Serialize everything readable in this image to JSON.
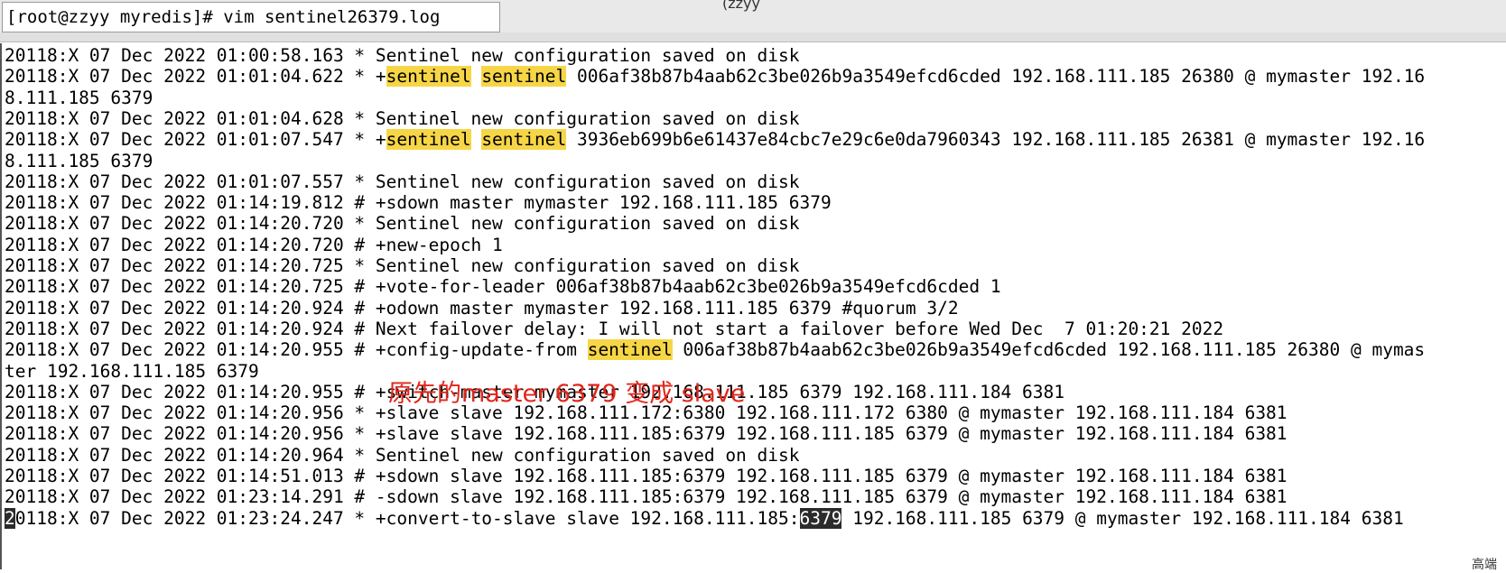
{
  "window": {
    "title_fragment": "(zzyy",
    "command": "[root@zzyy myredis]# vim sentinel26379.log"
  },
  "annotation": "原先的master 6379 变成 slave",
  "log_lines": [
    [
      {
        "t": "20118:X 07 Dec 2022 01:00:58.163 * Sentinel new configuration saved on disk"
      }
    ],
    [
      {
        "t": "20118:X 07 Dec 2022 01:01:04.622 * +"
      },
      {
        "t": "sentinel",
        "hl": true
      },
      {
        "t": " "
      },
      {
        "t": "sentinel",
        "hl": true
      },
      {
        "t": " 006af38b87b4aab62c3be026b9a3549efcd6cded 192.168.111.185 26380 @ mymaster 192.16"
      }
    ],
    [
      {
        "t": "8.111.185 6379"
      }
    ],
    [
      {
        "t": "20118:X 07 Dec 2022 01:01:04.628 * Sentinel new configuration saved on disk"
      }
    ],
    [
      {
        "t": "20118:X 07 Dec 2022 01:01:07.547 * +"
      },
      {
        "t": "sentinel",
        "hl": true
      },
      {
        "t": " "
      },
      {
        "t": "sentinel",
        "hl": true
      },
      {
        "t": " 3936eb699b6e61437e84cbc7e29c6e0da7960343 192.168.111.185 26381 @ mymaster 192.16"
      }
    ],
    [
      {
        "t": "8.111.185 6379"
      }
    ],
    [
      {
        "t": "20118:X 07 Dec 2022 01:01:07.557 * Sentinel new configuration saved on disk"
      }
    ],
    [
      {
        "t": "20118:X 07 Dec 2022 01:14:19.812 # +sdown master mymaster 192.168.111.185 6379"
      }
    ],
    [
      {
        "t": "20118:X 07 Dec 2022 01:14:20.720 * Sentinel new configuration saved on disk"
      }
    ],
    [
      {
        "t": "20118:X 07 Dec 2022 01:14:20.720 # +new-epoch 1"
      }
    ],
    [
      {
        "t": "20118:X 07 Dec 2022 01:14:20.725 * Sentinel new configuration saved on disk"
      }
    ],
    [
      {
        "t": "20118:X 07 Dec 2022 01:14:20.725 # +vote-for-leader 006af38b87b4aab62c3be026b9a3549efcd6cded 1"
      }
    ],
    [
      {
        "t": "20118:X 07 Dec 2022 01:14:20.924 # +odown master mymaster 192.168.111.185 6379 #quorum 3/2"
      }
    ],
    [
      {
        "t": "20118:X 07 Dec 2022 01:14:20.924 # Next failover delay: I will not start a failover before Wed Dec  7 01:20:21 2022"
      }
    ],
    [
      {
        "t": "20118:X 07 Dec 2022 01:14:20.955 # +config-update-from "
      },
      {
        "t": "sentinel",
        "hl": true
      },
      {
        "t": " 006af38b87b4aab62c3be026b9a3549efcd6cded 192.168.111.185 26380 @ mymas"
      }
    ],
    [
      {
        "t": "ter 192.168.111.185 6379"
      }
    ],
    [
      {
        "t": "20118:X 07 Dec 2022 01:14:20.955 # +switch-master mymaster 192.168.111.185 6379 192.168.111.184 6381"
      }
    ],
    [
      {
        "t": "20118:X 07 Dec 2022 01:14:20.956 * +slave slave 192.168.111.172:6380 192.168.111.172 6380 @ mymaster 192.168.111.184 6381"
      }
    ],
    [
      {
        "t": "20118:X 07 Dec 2022 01:14:20.956 * +slave slave 192.168.111.185:6379 192.168.111.185 6379 @ mymaster 192.168.111.184 6381"
      }
    ],
    [
      {
        "t": "20118:X 07 Dec 2022 01:14:20.964 * Sentinel new configuration saved on disk"
      }
    ],
    [
      {
        "t": "20118:X 07 Dec 2022 01:14:51.013 # +sdown slave 192.168.111.185:6379 192.168.111.185 6379 @ mymaster 192.168.111.184 6381"
      }
    ],
    [
      {
        "t": "20118:X 07 Dec 2022 01:23:14.291 # -sdown slave 192.168.111.185:6379 192.168.111.185 6379 @ mymaster 192.168.111.184 6381"
      }
    ],
    [
      {
        "t": "2",
        "cursor": true
      },
      {
        "t": "0118:X 07 Dec 2022 01:23:24.247 * +convert-to-slave slave 192.168.111.185:"
      },
      {
        "t": "6379",
        "cursor": true
      },
      {
        "t": " 192.168.111.185 6379 @ mymaster 192.168.111.184 6381"
      }
    ]
  ],
  "corner_fragment": "高端"
}
